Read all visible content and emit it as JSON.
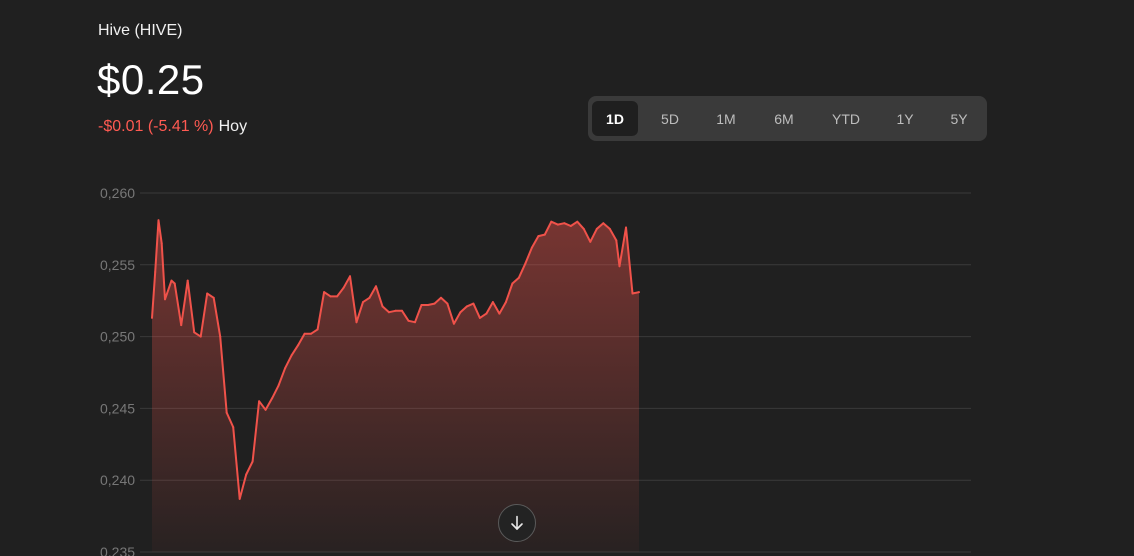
{
  "header": {
    "asset_name": "Hive (HIVE)",
    "price": "$0.25",
    "change": "-$0.01 (-5.41 %)",
    "period": "Hoy"
  },
  "range_selector": {
    "options": [
      "1D",
      "5D",
      "1M",
      "6M",
      "YTD",
      "1Y",
      "5Y"
    ],
    "selected": "1D"
  },
  "colors": {
    "line": "#f0524a",
    "negative_change": "#ff5a52",
    "background": "#202020",
    "gridline": "#3a3a3a"
  },
  "scroll_button_icon": "arrow-down-icon",
  "chart_data": {
    "type": "area",
    "title": "",
    "xlabel": "",
    "ylabel": "",
    "ylim": [
      0.235,
      0.26
    ],
    "y_ticks": [
      "0,235",
      "0,240",
      "0,245",
      "0,250",
      "0,255",
      "0,260"
    ],
    "grid": true,
    "x_index_max": 150,
    "series": [
      {
        "values": [
          [
            0,
            0.2513
          ],
          [
            1,
            0.2545
          ],
          [
            2,
            0.2581
          ],
          [
            3,
            0.2565
          ],
          [
            4,
            0.2526
          ],
          [
            6,
            0.2539
          ],
          [
            7,
            0.2537
          ],
          [
            9,
            0.2508
          ],
          [
            11,
            0.2539
          ],
          [
            13,
            0.2503
          ],
          [
            15,
            0.25
          ],
          [
            17,
            0.253
          ],
          [
            19,
            0.2527
          ],
          [
            21,
            0.25
          ],
          [
            23,
            0.2447
          ],
          [
            25,
            0.2437
          ],
          [
            27,
            0.2387
          ],
          [
            29,
            0.2404
          ],
          [
            31,
            0.2413
          ],
          [
            33,
            0.2455
          ],
          [
            35,
            0.2449
          ],
          [
            37,
            0.2457
          ],
          [
            39,
            0.2466
          ],
          [
            41,
            0.2478
          ],
          [
            43,
            0.2487
          ],
          [
            45,
            0.2494
          ],
          [
            47,
            0.2502
          ],
          [
            49,
            0.2502
          ],
          [
            51,
            0.2505
          ],
          [
            53,
            0.2531
          ],
          [
            55,
            0.2528
          ],
          [
            57,
            0.2528
          ],
          [
            59,
            0.2534
          ],
          [
            61,
            0.2542
          ],
          [
            63,
            0.251
          ],
          [
            65,
            0.2524
          ],
          [
            67,
            0.2527
          ],
          [
            69,
            0.2535
          ],
          [
            71,
            0.2521
          ],
          [
            73,
            0.2517
          ],
          [
            75,
            0.2518
          ],
          [
            77,
            0.2518
          ],
          [
            79,
            0.2511
          ],
          [
            81,
            0.251
          ],
          [
            83,
            0.2522
          ],
          [
            85,
            0.2522
          ],
          [
            87,
            0.2523
          ],
          [
            89,
            0.2527
          ],
          [
            91,
            0.2523
          ],
          [
            93,
            0.2509
          ],
          [
            95,
            0.2517
          ],
          [
            97,
            0.2521
          ],
          [
            99,
            0.2523
          ],
          [
            101,
            0.2513
          ],
          [
            103,
            0.2516
          ],
          [
            105,
            0.2524
          ],
          [
            107,
            0.2516
          ],
          [
            109,
            0.2524
          ],
          [
            111,
            0.2537
          ],
          [
            113,
            0.2541
          ],
          [
            115,
            0.2551
          ],
          [
            117,
            0.2562
          ],
          [
            119,
            0.257
          ],
          [
            121,
            0.2571
          ],
          [
            123,
            0.258
          ],
          [
            125,
            0.2578
          ],
          [
            127,
            0.2579
          ],
          [
            129,
            0.2577
          ],
          [
            131,
            0.258
          ],
          [
            133,
            0.2575
          ],
          [
            135,
            0.2566
          ],
          [
            137,
            0.2575
          ],
          [
            139,
            0.2579
          ],
          [
            141,
            0.2575
          ],
          [
            143,
            0.2567
          ],
          [
            144,
            0.2549
          ],
          [
            146,
            0.2576
          ],
          [
            148,
            0.253
          ],
          [
            150,
            0.2531
          ]
        ]
      }
    ]
  }
}
